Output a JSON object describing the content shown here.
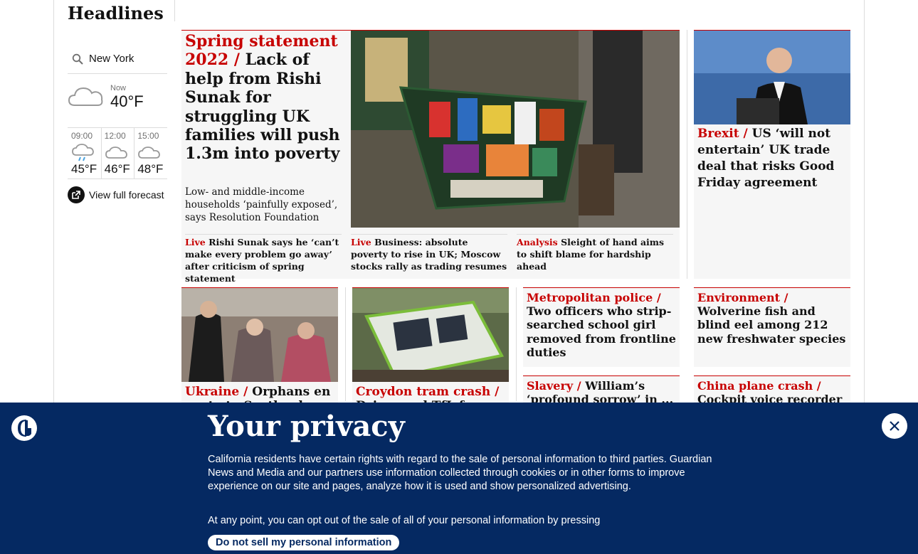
{
  "section": {
    "title": "Headlines"
  },
  "weather": {
    "location": "New York",
    "now_label": "Now",
    "now_temp": "40°F",
    "forecast": [
      {
        "time": "09:00",
        "temp": "45°F",
        "icon": "rain-cloud-icon"
      },
      {
        "time": "12:00",
        "temp": "46°F",
        "icon": "cloud-icon"
      },
      {
        "time": "15:00",
        "temp": "48°F",
        "icon": "cloud-icon"
      }
    ],
    "full_forecast_label": "View full forecast"
  },
  "lead_story": {
    "kicker": "Spring statement 2022 /",
    "headline": "Lack of help from Rishi Sunak for struggling UK families will push 1.3m into poverty",
    "standfirst": "Low- and middle-income households ‘painfully exposed’, says Resolution Foundation",
    "sublinks": [
      {
        "kicker": "Live",
        "text": "Rishi Sunak says he ‘can’t make every problem go away’ after criticism of spring statement"
      },
      {
        "kicker": "Live",
        "text": "Business: absolute poverty to rise in UK; Moscow stocks rally as trading resumes"
      },
      {
        "kicker": "Analysis",
        "text": "Sleight of hand aims to shift blame for hardship ahead"
      }
    ]
  },
  "right_lead": {
    "kicker": "Brexit /",
    "headline": "US ‘will not entertain’ UK trade deal that risks Good Friday agreement"
  },
  "cards": [
    {
      "kicker": "Ukraine /",
      "headline": "Orphans en route to Scotland after ..."
    },
    {
      "kicker": "Croydon tram crash /",
      "headline": "Driver and TfL face ..."
    },
    {
      "kicker": "Metropolitan police  /",
      "headline": "Two officers who strip-searched school girl removed from frontline duties"
    },
    {
      "kicker": "Environment /",
      "headline": "Wolverine fish and blind eel among 212 new freshwater species"
    },
    {
      "kicker": "Slavery /",
      "headline": "William’s ‘profound sorrow’ in ..."
    },
    {
      "kicker": "China plane crash /",
      "headline": "Cockpit voice recorder ..."
    }
  ],
  "privacy": {
    "title": "Your privacy",
    "text1": "California residents have certain rights with regard to the sale of personal information to third parties. Guardian News and Media and our partners use information collected through cookies or in other forms to improve experience on our site and pages, analyze how it is used and show personalized advertising.",
    "text2": "At any point, you can opt out of the sale of all of your personal information by pressing",
    "button_label": "Do not sell my personal information"
  },
  "colors": {
    "accent": "#c70000",
    "privacy_bg": "#052962"
  }
}
